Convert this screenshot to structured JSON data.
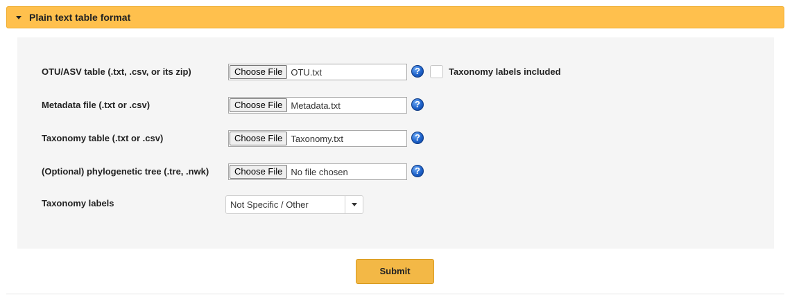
{
  "accordion": {
    "title": "Plain text table format"
  },
  "form": {
    "otu_table": {
      "label": "OTU/ASV table (.txt, .csv, or its zip)",
      "button": "Choose File",
      "filename": "OTU.txt",
      "help_icon": "question-icon",
      "checkbox_label": "Taxonomy labels included",
      "checkbox_checked": false
    },
    "metadata": {
      "label": "Metadata file (.txt or .csv)",
      "button": "Choose File",
      "filename": "Metadata.txt",
      "help_icon": "question-icon"
    },
    "taxonomy_table": {
      "label": "Taxonomy table (.txt or .csv)",
      "button": "Choose File",
      "filename": "Taxonomy.txt",
      "help_icon": "question-icon"
    },
    "tree": {
      "label": "(Optional) phylogenetic tree (.tre, .nwk)",
      "button": "Choose File",
      "filename": "No file chosen",
      "help_icon": "question-icon"
    },
    "taxonomy_labels": {
      "label": "Taxonomy labels",
      "selected": "Not Specific / Other"
    }
  },
  "submit": {
    "label": "Submit"
  },
  "colors": {
    "accordion_bg": "#ffc04d",
    "panel_bg": "#f5f5f5",
    "submit_bg": "#f3b846",
    "help_icon": "#1f62c9"
  }
}
